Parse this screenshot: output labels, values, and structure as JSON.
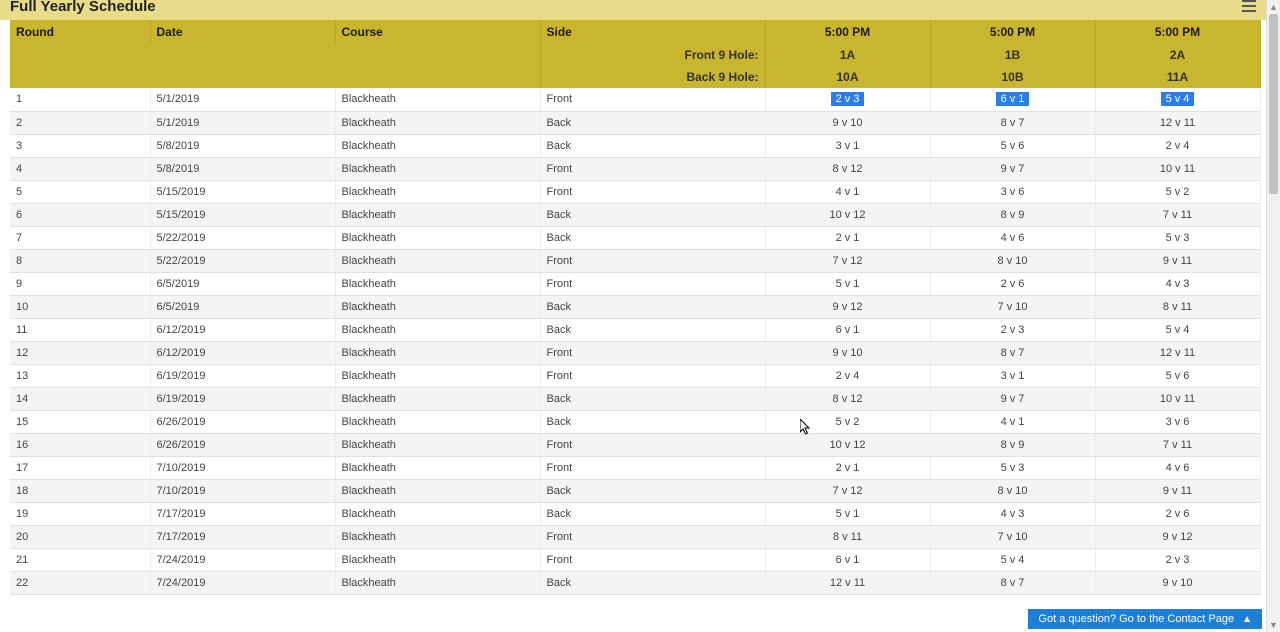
{
  "title": "Full Yearly Schedule",
  "columns": {
    "round": "Round",
    "date": "Date",
    "course": "Course",
    "side": "Side"
  },
  "time_headers": [
    "5:00 PM",
    "5:00 PM",
    "5:00 PM"
  ],
  "front9_label": "Front 9 Hole:",
  "back9_label": "Back 9 Hole:",
  "front9_values": [
    "1A",
    "1B",
    "2A"
  ],
  "back9_values": [
    "10A",
    "10B",
    "11A"
  ],
  "highlight_row_index": 0,
  "rows": [
    {
      "round": "1",
      "date": "5/1/2019",
      "course": "Blackheath",
      "side": "Front",
      "m": [
        "2 v 3",
        "6 v 1",
        "5 v 4"
      ]
    },
    {
      "round": "2",
      "date": "5/1/2019",
      "course": "Blackheath",
      "side": "Back",
      "m": [
        "9 v 10",
        "8 v 7",
        "12 v 11"
      ]
    },
    {
      "round": "3",
      "date": "5/8/2019",
      "course": "Blackheath",
      "side": "Back",
      "m": [
        "3 v 1",
        "5 v 6",
        "2 v 4"
      ]
    },
    {
      "round": "4",
      "date": "5/8/2019",
      "course": "Blackheath",
      "side": "Front",
      "m": [
        "8 v 12",
        "9 v 7",
        "10 v 11"
      ]
    },
    {
      "round": "5",
      "date": "5/15/2019",
      "course": "Blackheath",
      "side": "Front",
      "m": [
        "4 v 1",
        "3 v 6",
        "5 v 2"
      ]
    },
    {
      "round": "6",
      "date": "5/15/2019",
      "course": "Blackheath",
      "side": "Back",
      "m": [
        "10 v 12",
        "8 v 9",
        "7 v 11"
      ]
    },
    {
      "round": "7",
      "date": "5/22/2019",
      "course": "Blackheath",
      "side": "Back",
      "m": [
        "2 v 1",
        "4 v 6",
        "5 v 3"
      ]
    },
    {
      "round": "8",
      "date": "5/22/2019",
      "course": "Blackheath",
      "side": "Front",
      "m": [
        "7 v 12",
        "8 v 10",
        "9 v 11"
      ]
    },
    {
      "round": "9",
      "date": "6/5/2019",
      "course": "Blackheath",
      "side": "Front",
      "m": [
        "5 v 1",
        "2 v 6",
        "4 v 3"
      ]
    },
    {
      "round": "10",
      "date": "6/5/2019",
      "course": "Blackheath",
      "side": "Back",
      "m": [
        "9 v 12",
        "7 v 10",
        "8 v 11"
      ]
    },
    {
      "round": "11",
      "date": "6/12/2019",
      "course": "Blackheath",
      "side": "Back",
      "m": [
        "6 v 1",
        "2 v 3",
        "5 v 4"
      ]
    },
    {
      "round": "12",
      "date": "6/12/2019",
      "course": "Blackheath",
      "side": "Front",
      "m": [
        "9 v 10",
        "8 v 7",
        "12 v 11"
      ]
    },
    {
      "round": "13",
      "date": "6/19/2019",
      "course": "Blackheath",
      "side": "Front",
      "m": [
        "2 v 4",
        "3 v 1",
        "5 v 6"
      ]
    },
    {
      "round": "14",
      "date": "6/19/2019",
      "course": "Blackheath",
      "side": "Back",
      "m": [
        "8 v 12",
        "9 v 7",
        "10 v 11"
      ]
    },
    {
      "round": "15",
      "date": "6/26/2019",
      "course": "Blackheath",
      "side": "Back",
      "m": [
        "5 v 2",
        "4 v 1",
        "3 v 6"
      ]
    },
    {
      "round": "16",
      "date": "6/26/2019",
      "course": "Blackheath",
      "side": "Front",
      "m": [
        "10 v 12",
        "8 v 9",
        "7 v 11"
      ]
    },
    {
      "round": "17",
      "date": "7/10/2019",
      "course": "Blackheath",
      "side": "Front",
      "m": [
        "2 v 1",
        "5 v 3",
        "4 v 6"
      ]
    },
    {
      "round": "18",
      "date": "7/10/2019",
      "course": "Blackheath",
      "side": "Back",
      "m": [
        "7 v 12",
        "8 v 10",
        "9 v 11"
      ]
    },
    {
      "round": "19",
      "date": "7/17/2019",
      "course": "Blackheath",
      "side": "Back",
      "m": [
        "5 v 1",
        "4 v 3",
        "2 v 6"
      ]
    },
    {
      "round": "20",
      "date": "7/17/2019",
      "course": "Blackheath",
      "side": "Front",
      "m": [
        "8 v 11",
        "7 v 10",
        "9 v 12"
      ]
    },
    {
      "round": "21",
      "date": "7/24/2019",
      "course": "Blackheath",
      "side": "Front",
      "m": [
        "6 v 1",
        "5 v 4",
        "2 v 3"
      ]
    },
    {
      "round": "22",
      "date": "7/24/2019",
      "course": "Blackheath",
      "side": "Back",
      "m": [
        "12 v 11",
        "8 v 7",
        "9 v 10"
      ]
    }
  ],
  "contact_text": "Got a question? Go to the Contact Page"
}
